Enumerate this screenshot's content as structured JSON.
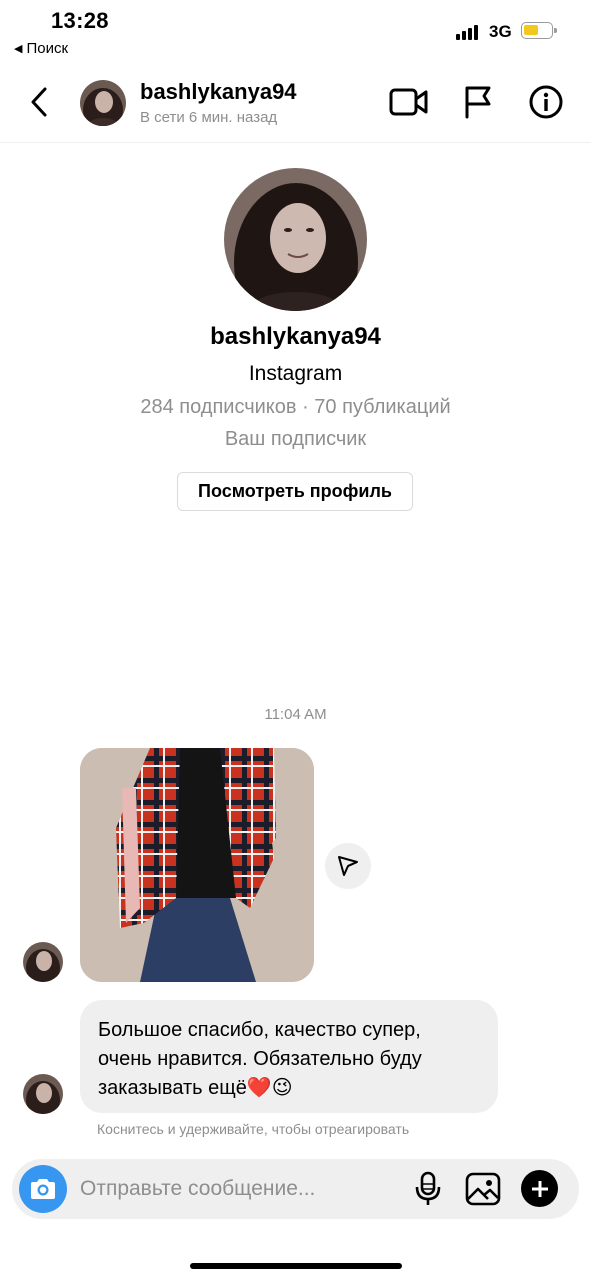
{
  "status_bar": {
    "time": "13:28",
    "back_app": "Поиск",
    "network": "3G",
    "battery_color": "#f2c81d"
  },
  "header": {
    "username": "bashlykanya94",
    "status": "В сети 6 мин. назад",
    "icons": [
      "chevron-left-icon",
      "video-call-icon",
      "flag-icon",
      "info-icon"
    ]
  },
  "profile": {
    "username": "bashlykanya94",
    "platform": "Instagram",
    "stats": "284 подписчиков · 70 публикаций",
    "follow_status": "Ваш подписчик",
    "view_profile_button": "Посмотреть профиль"
  },
  "chat": {
    "timestamp": "11:04 AM",
    "messages": [
      {
        "type": "photo",
        "description": "plaid-shirt-photo"
      },
      {
        "type": "text",
        "text": "Большое спасибо, качество супер, очень нравится. Обязательно буду заказывать ещё❤️😉"
      }
    ],
    "hint": "Коснитесь и удерживайте, чтобы отреагировать"
  },
  "composer": {
    "placeholder": "Отправьте сообщение...",
    "accent_color": "#3797f0"
  }
}
